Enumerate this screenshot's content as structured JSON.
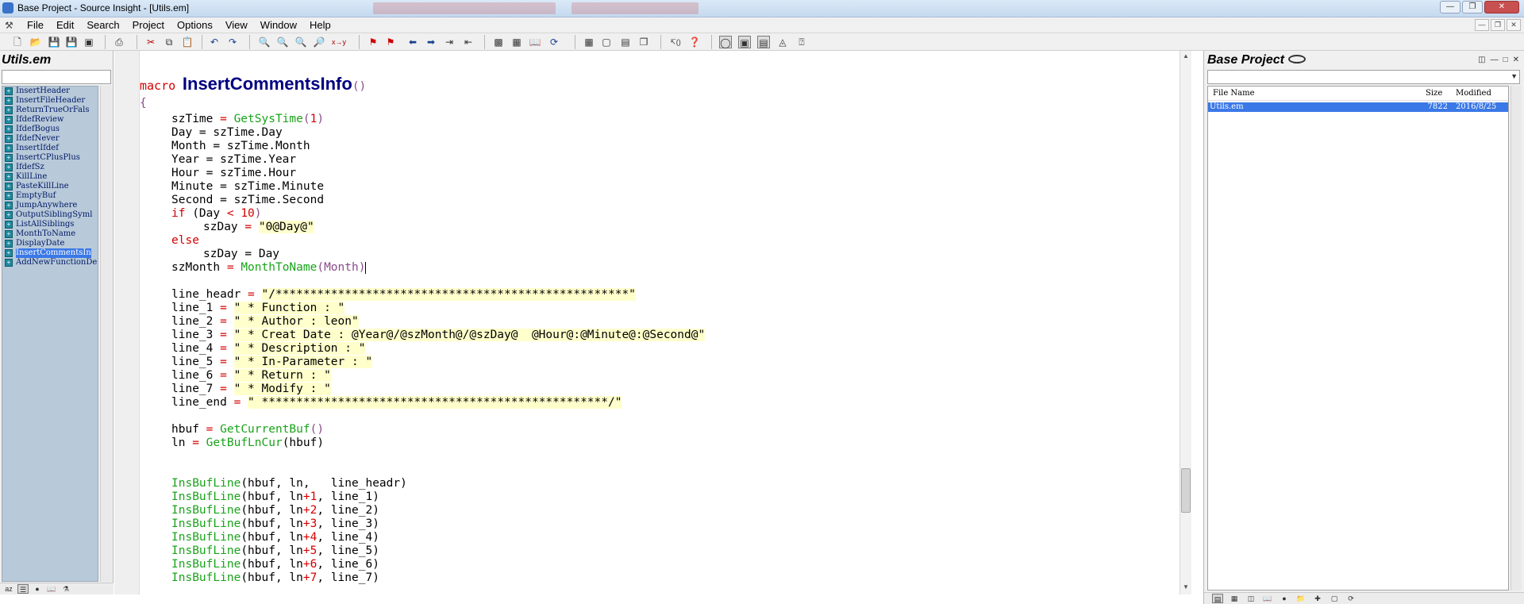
{
  "window": {
    "title": "Base Project - Source Insight - [Utils.em]",
    "controls": [
      "minimize",
      "restore",
      "close"
    ]
  },
  "menu": [
    "File",
    "Edit",
    "Search",
    "Project",
    "Options",
    "View",
    "Window",
    "Help"
  ],
  "symbol_panel": {
    "title": "Utils.em",
    "symbols": [
      "InsertHeader",
      "InsertFileHeader",
      "ReturnTrueOrFals",
      "IfdefReview",
      "IfdefBogus",
      "IfdefNever",
      "InsertIfdef",
      "InsertCPlusPlus",
      "IfdefSz",
      "KillLine",
      "PasteKillLine",
      "EmptyBuf",
      "JumpAnywhere",
      "OutputSiblingSyml",
      "ListAllSiblings",
      "MonthToName",
      "DisplayDate",
      "InsertCommentsIn",
      "AddNewFunctionDe"
    ],
    "selected_symbol": "InsertCommentsIn"
  },
  "editor": {
    "macro_keyword": "macro",
    "macro_name": "InsertCommentsInfo",
    "macro_params": "()",
    "open_brace": "{",
    "lines": {
      "l1": {
        "a": "szTime ",
        "op": "=",
        "sp": " ",
        "fn": "GetSysTime",
        "p1": "(",
        "num": "1",
        "p2": ")"
      },
      "l2": "Day = szTime.Day",
      "l3": "Month = szTime.Month",
      "l4": "Year = szTime.Year",
      "l5": "Hour = szTime.Hour",
      "l6": "Minute = szTime.Minute",
      "l7": "Second = szTime.Second",
      "l8": {
        "kw": "if",
        "a": " (Day ",
        "op": "<",
        "sp": " ",
        "num": "10",
        "p2": ")"
      },
      "l9": {
        "a": "szDay ",
        "op": "=",
        "sp": " ",
        "str": "\"0@Day@\""
      },
      "l10": "else",
      "l11": "szDay = Day",
      "l12": {
        "a": "szMonth ",
        "op": "=",
        "sp": " ",
        "fn": "MonthToName",
        "args": "(Month)"
      },
      "headr": {
        "a": "line_headr ",
        "op": "=",
        "sp": " ",
        "str": "\"/***************************************************\""
      },
      "c1": {
        "a": "line_1 ",
        "op": "=",
        "sp": " ",
        "str": "\" * Function : \""
      },
      "c2": {
        "a": "line_2 ",
        "op": "=",
        "sp": " ",
        "str": "\" * Author : leon\""
      },
      "c3": {
        "a": "line_3 ",
        "op": "=",
        "sp": " ",
        "str": "\" * Creat Date : @Year@/@szMonth@/@szDay@  @Hour@:@Minute@:@Second@\""
      },
      "c4": {
        "a": "line_4 ",
        "op": "=",
        "sp": " ",
        "str": "\" * Description : \""
      },
      "c5": {
        "a": "line_5 ",
        "op": "=",
        "sp": " ",
        "str": "\" * In-Parameter : \""
      },
      "c6": {
        "a": "line_6 ",
        "op": "=",
        "sp": " ",
        "str": "\" * Return : \""
      },
      "c7": {
        "a": "line_7 ",
        "op": "=",
        "sp": " ",
        "str": "\" * Modify : \""
      },
      "cend": {
        "a": "line_end ",
        "op": "=",
        "sp": " ",
        "str": "\" **************************************************/\""
      },
      "hbuf": {
        "a": "hbuf ",
        "op": "=",
        "sp": " ",
        "fn": "GetCurrentBuf",
        "args": "()"
      },
      "ln": {
        "a": "ln ",
        "op": "=",
        "sp": " ",
        "fn": "GetBufLnCur",
        "args": "(hbuf)"
      },
      "ins": [
        {
          "fn": "InsBufLine",
          "args_a": "(hbuf, ",
          "ln": "ln",
          "plus": "",
          "num": "",
          "args_b": ",   line_headr)"
        },
        {
          "fn": "InsBufLine",
          "args_a": "(hbuf, ",
          "ln": "ln",
          "plus": "+",
          "num": "1",
          "args_b": ", line_1)"
        },
        {
          "fn": "InsBufLine",
          "args_a": "(hbuf, ",
          "ln": "ln",
          "plus": "+",
          "num": "2",
          "args_b": ", line_2)"
        },
        {
          "fn": "InsBufLine",
          "args_a": "(hbuf, ",
          "ln": "ln",
          "plus": "+",
          "num": "3",
          "args_b": ", line_3)"
        },
        {
          "fn": "InsBufLine",
          "args_a": "(hbuf, ",
          "ln": "ln",
          "plus": "+",
          "num": "4",
          "args_b": ", line_4)"
        },
        {
          "fn": "InsBufLine",
          "args_a": "(hbuf, ",
          "ln": "ln",
          "plus": "+",
          "num": "5",
          "args_b": ", line_5)"
        },
        {
          "fn": "InsBufLine",
          "args_a": "(hbuf, ",
          "ln": "ln",
          "plus": "+",
          "num": "6",
          "args_b": ", line_6)"
        },
        {
          "fn": "InsBufLine",
          "args_a": "(hbuf, ",
          "ln": "ln",
          "plus": "+",
          "num": "7",
          "args_b": ", line_7)"
        }
      ]
    }
  },
  "project_panel": {
    "title": "Base Project",
    "columns": [
      "File Name",
      "Size",
      "Modified"
    ],
    "files": [
      {
        "name": "Utils.em",
        "size": "7822",
        "modified": "2016/8/25"
      }
    ]
  },
  "colors": {
    "keyword": "#d40000",
    "function": "#19a319",
    "string_bg": "#ffffcc",
    "macro_name": "#000080",
    "selection": "#3b78e7",
    "symbol_list_bg": "#b8c9d9"
  }
}
